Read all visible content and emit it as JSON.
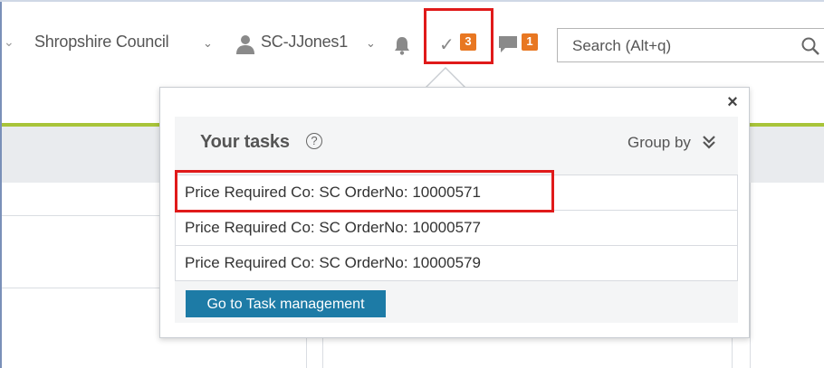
{
  "header": {
    "org_name": "Shropshire Council",
    "user_name": "SC-JJones1",
    "tasks_count": "3",
    "messages_count": "1",
    "search_placeholder": "Search (Alt+q)"
  },
  "tasks_popup": {
    "title": "Your tasks",
    "help_glyph": "?",
    "close_glyph": "×",
    "group_by_label": "Group by",
    "items": [
      {
        "label": "Price Required Co: SC OrderNo: 10000571"
      },
      {
        "label": "Price Required Co: SC OrderNo: 10000577"
      },
      {
        "label": "Price Required Co: SC OrderNo: 10000579"
      }
    ],
    "task_management_button": "Go to Task management"
  },
  "icons": {
    "user": "user-icon",
    "bell": "bell-icon",
    "tasks": "checkmark-icon",
    "messages": "chat-bubble-icon",
    "search": "search-icon",
    "group_by": "double-chevron-down-icon"
  },
  "colors": {
    "badge": "#e87722",
    "highlight": "#e01a1a",
    "accent_line": "#a8c439",
    "button": "#1d7ba6"
  }
}
